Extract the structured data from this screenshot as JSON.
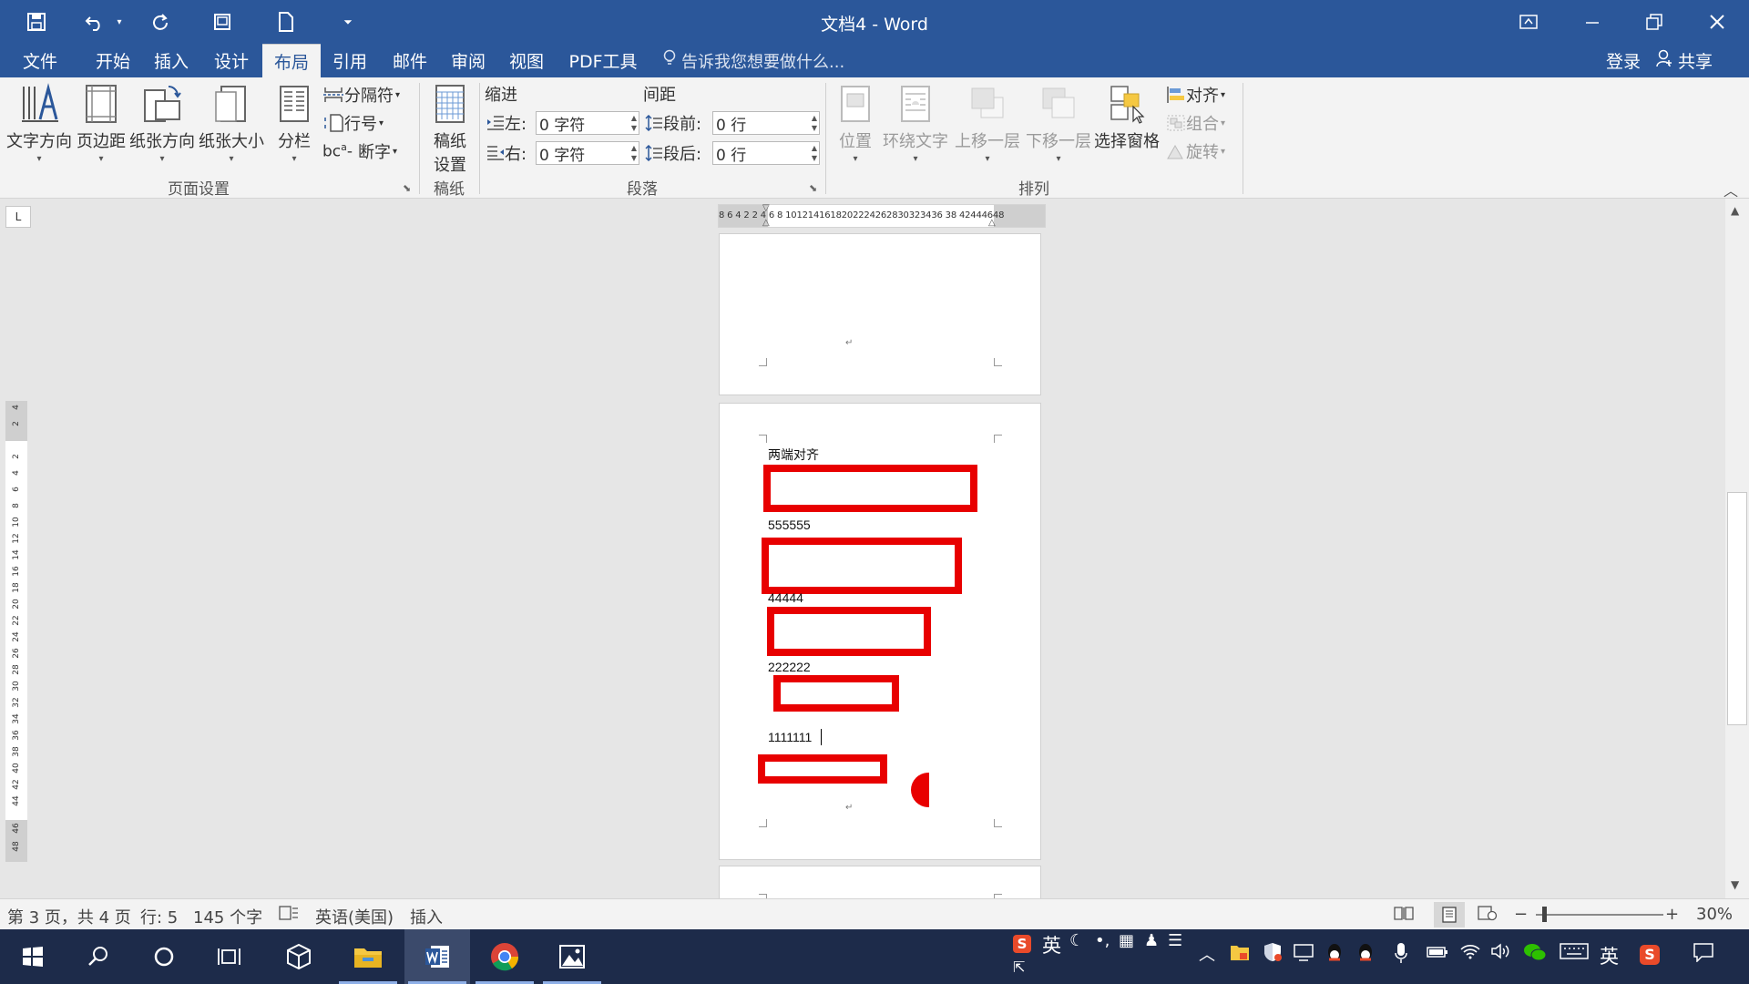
{
  "window": {
    "title": "文档4 - Word",
    "quick_access": {
      "save_icon": "save-icon",
      "undo_icon": "undo-icon",
      "redo_icon": "redo-icon",
      "print_preview_icon": "print-preview-icon",
      "new_icon": "new-document-icon",
      "customize_icon": "customize-qat-icon"
    },
    "controls": {
      "ribbon_display_icon": "ribbon-display-options-icon",
      "minimize_icon": "minimize-icon",
      "restore_icon": "restore-icon",
      "close_icon": "close-icon"
    }
  },
  "tabs": [
    {
      "label": "文件",
      "active": false
    },
    {
      "label": "开始",
      "active": false
    },
    {
      "label": "插入",
      "active": false
    },
    {
      "label": "设计",
      "active": false
    },
    {
      "label": "布局",
      "active": true
    },
    {
      "label": "引用",
      "active": false
    },
    {
      "label": "邮件",
      "active": false
    },
    {
      "label": "审阅",
      "active": false
    },
    {
      "label": "视图",
      "active": false
    },
    {
      "label": "PDF工具",
      "active": false
    }
  ],
  "tell_me": "告诉我您想要做什么...",
  "account": {
    "sign_in": "登录",
    "share": "共享"
  },
  "ribbon": {
    "page_setup": {
      "label": "页面设置",
      "text_direction": "文字方向",
      "margins": "页边距",
      "orientation": "纸张方向",
      "size": "纸张大小",
      "columns": "分栏",
      "breaks": "分隔符",
      "line_numbers": "行号",
      "hyphenation": "断字"
    },
    "draft_paper": {
      "label": "稿纸",
      "settings_line1": "稿纸",
      "settings_line2": "设置"
    },
    "paragraph": {
      "label": "段落",
      "indent_title": "缩进",
      "spacing_title": "间距",
      "indent_left_label": "左:",
      "indent_left_value": "0 字符",
      "indent_right_label": "右:",
      "indent_right_value": "0 字符",
      "space_before_label": "段前:",
      "space_before_value": "0 行",
      "space_after_label": "段后:",
      "space_after_value": "0 行"
    },
    "arrange": {
      "label": "排列",
      "position": "位置",
      "wrap_text": "环绕文字",
      "bring_forward": "上移一层",
      "send_backward": "下移一层",
      "selection_pane": "选择窗格",
      "align": "对齐",
      "group": "组合",
      "rotate": "旋转"
    }
  },
  "ruler": {
    "corner": "L",
    "h_ticks": "8  6  4  2       2  4  6  8 1012141618202224262830323436 38     42444648",
    "v_top": [
      "4",
      "2"
    ],
    "v_ticks": [
      "2",
      "4",
      "6",
      "8",
      "10",
      "12",
      "14",
      "16",
      "18",
      "20",
      "22",
      "24",
      "26",
      "28",
      "30",
      "32",
      "34",
      "36",
      "38",
      "40",
      "42",
      "44"
    ],
    "v_bottom": [
      "46",
      "48"
    ]
  },
  "document": {
    "lines": [
      "两端对齐",
      "555555",
      "44444",
      "222222",
      "1111111"
    ]
  },
  "status": {
    "page": "第 3 页，共 4 页",
    "line": "行: 5",
    "words": "145 个字",
    "language": "英语(美国)",
    "mode": "插入",
    "zoom": "30%",
    "zoom_minus": "−",
    "zoom_plus": "+"
  },
  "taskbar": {
    "start_icon": "windows-start-icon",
    "search_icon": "search-icon",
    "cortana_icon": "cortana-icon",
    "task_view_icon": "task-view-icon",
    "apps": [
      {
        "name": "3d-builder-icon"
      },
      {
        "name": "file-explorer-icon"
      },
      {
        "name": "word-icon",
        "active": true
      },
      {
        "name": "chrome-icon"
      },
      {
        "name": "photos-icon"
      }
    ],
    "ime_label": "英",
    "tray_ime": "英"
  }
}
